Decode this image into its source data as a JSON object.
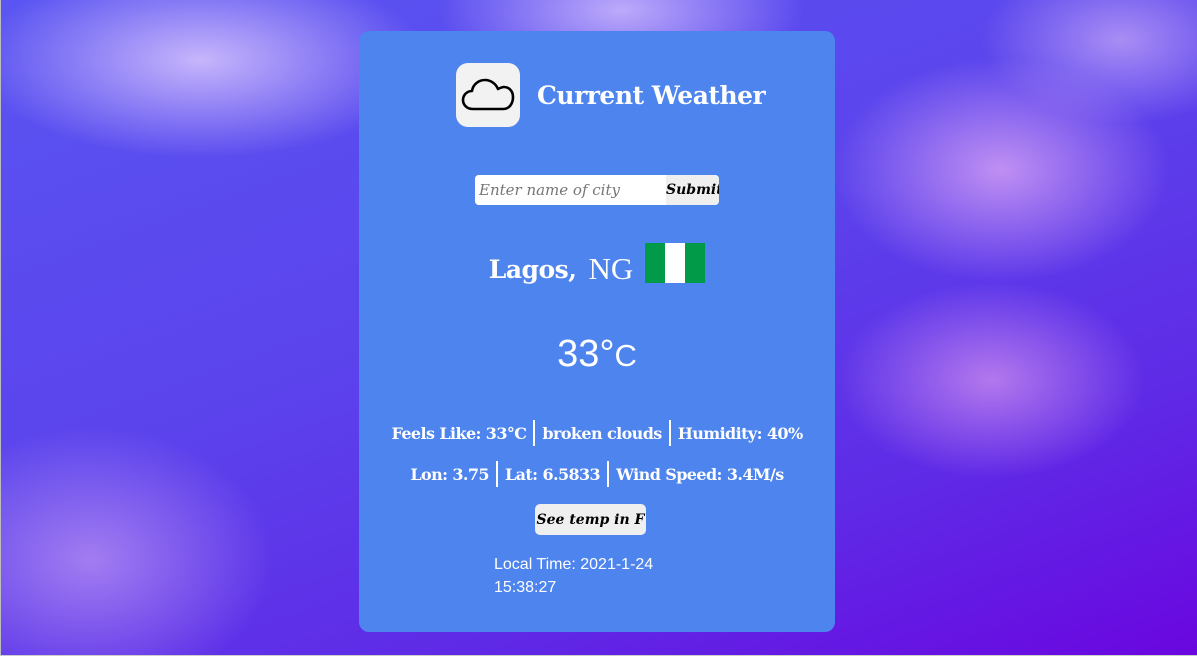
{
  "header": {
    "title": "Current Weather",
    "icon": "cloud-icon"
  },
  "search": {
    "placeholder": "Enter name of city",
    "value": "",
    "submit_label": "Submit"
  },
  "location": {
    "city": "Lagos,",
    "country": "NG",
    "flag_colors": [
      "#009a49",
      "#ffffff",
      "#009a49"
    ]
  },
  "weather": {
    "temperature": "33°",
    "unit": "C",
    "feels_like": "Feels Like: 33°C",
    "description": "broken clouds",
    "humidity": "Humidity: 40%",
    "lon": "Lon: 3.75",
    "lat": "Lat: 6.5833",
    "wind_speed": "Wind Speed: 3.4M/s"
  },
  "toggle_label": "See temp in F",
  "local_time": {
    "label": "Local Time: 2021-1-24",
    "time": "15:38:27"
  },
  "colors": {
    "card": "#4d84ed",
    "background_top": "#5a55f2",
    "background_bottom": "#6a06e0"
  }
}
